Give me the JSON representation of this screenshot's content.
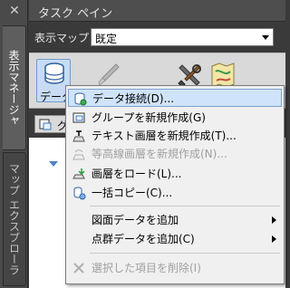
{
  "panel": {
    "title": "タスク ペイン",
    "map_label": "表示マップ",
    "map_value": "既定"
  },
  "side_tabs": [
    {
      "label": "表示マネージャ",
      "active": true
    },
    {
      "label": "マップ エクスプローラ",
      "active": false
    }
  ],
  "toolbar": {
    "data_label": "データ",
    "icons": [
      "data-stack-icon",
      "brush-icon",
      "tools-icon",
      "map-icon"
    ]
  },
  "strip": {
    "text": "グ"
  },
  "menu": {
    "items": [
      {
        "label": "データ接続(D)...",
        "icon": "data-connect-icon",
        "highlighted": true,
        "disabled": false,
        "submenu": false
      },
      {
        "label": "グループを新規作成(G)",
        "icon": "group-icon",
        "highlighted": false,
        "disabled": false,
        "submenu": false
      },
      {
        "label": "テキスト画層を新規作成(T)...",
        "icon": "text-layer-icon",
        "highlighted": false,
        "disabled": false,
        "submenu": false
      },
      {
        "label": "等高線画層を新規作成(N)...",
        "icon": "contour-icon",
        "highlighted": false,
        "disabled": true,
        "submenu": false
      },
      {
        "label": "画層をロード(L)...",
        "icon": "load-layer-icon",
        "highlighted": false,
        "disabled": false,
        "submenu": false
      },
      {
        "label": "一括コピー(C)...",
        "icon": "copy-icon",
        "highlighted": false,
        "disabled": false,
        "submenu": false
      },
      {
        "label": "図面データを追加",
        "icon": "",
        "highlighted": false,
        "disabled": false,
        "submenu": true
      },
      {
        "label": "点群データを追加(C)",
        "icon": "",
        "highlighted": false,
        "disabled": false,
        "submenu": true
      },
      {
        "label": "選択した項目を削除(I)",
        "icon": "delete-icon",
        "highlighted": false,
        "disabled": true,
        "submenu": false
      }
    ]
  },
  "colors": {
    "highlight": "#cfe3fa",
    "accent": "#3a76c4",
    "disabled": "#a0a0a0"
  }
}
